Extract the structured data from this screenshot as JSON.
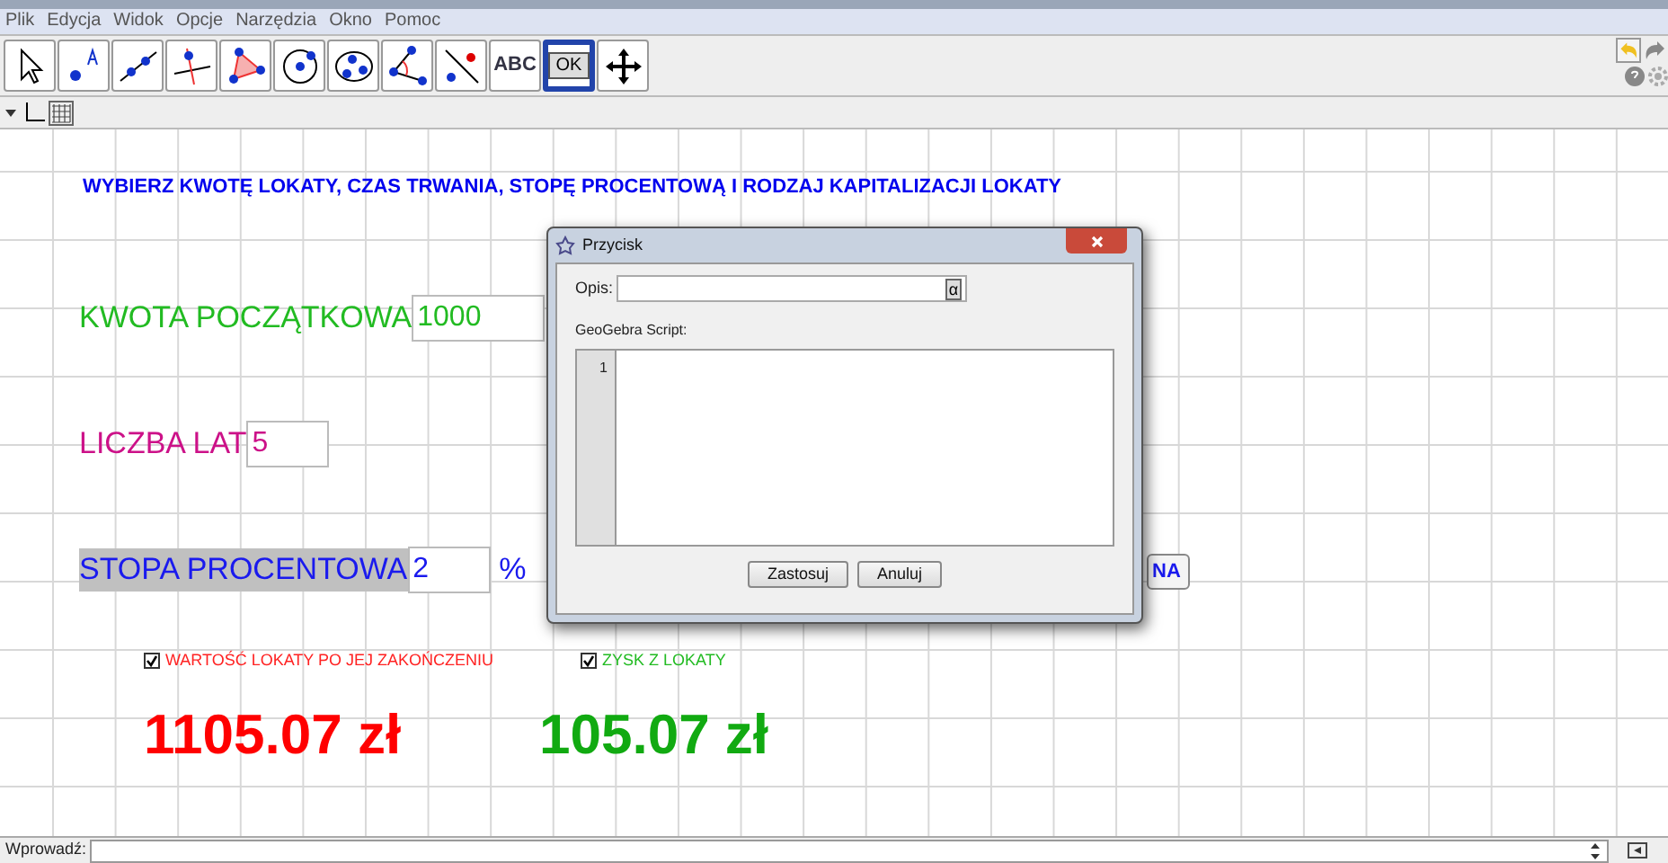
{
  "menu": [
    "Plik",
    "Edycja",
    "Widok",
    "Opcje",
    "Narzędzia",
    "Okno",
    "Pomoc"
  ],
  "tools": [
    {
      "kind": "pointer",
      "selected": false
    },
    {
      "kind": "point",
      "selected": false
    },
    {
      "kind": "line",
      "selected": false
    },
    {
      "kind": "perpendicular",
      "selected": false
    },
    {
      "kind": "polygon",
      "selected": false
    },
    {
      "kind": "circle",
      "selected": false
    },
    {
      "kind": "conic",
      "selected": false
    },
    {
      "kind": "angle",
      "selected": false
    },
    {
      "kind": "reflect",
      "selected": false
    },
    {
      "kind": "text",
      "label": "ABC",
      "selected": false
    },
    {
      "kind": "button",
      "label": "OK",
      "selected": true
    },
    {
      "kind": "move",
      "selected": false
    }
  ],
  "canvas": {
    "heading": "WYBIERZ KWOTĘ LOKATY, CZAS TRWANIA, STOPĘ PROCENTOWĄ I RODZAJ KAPITALIZACJI LOKATY",
    "inputs": [
      {
        "label": "KWOTA POCZĄTKOWA",
        "value": "1000",
        "color": "#22bb22",
        "highlighted": false
      },
      {
        "label": "LICZBA LAT",
        "value": "5",
        "color": "#cc1188",
        "highlighted": false
      },
      {
        "label": "STOPA PROCENTOWA",
        "value": "2",
        "suffix": "%",
        "color": "#1a1aee",
        "highlighted": true
      }
    ],
    "hidden_button": "NA",
    "checkboxes": [
      {
        "label": "WARTOŚĆ LOKATY PO JEJ ZAKOŃCZENIU",
        "checked": true,
        "color": "#ff2222"
      },
      {
        "label": "ZYSK Z LOKATY",
        "checked": true,
        "color": "#22bb22"
      }
    ],
    "results": [
      {
        "text": "1105.07 zł",
        "color": "#ff0000"
      },
      {
        "text": "105.07 zł",
        "color": "#11aa11"
      }
    ]
  },
  "dialog": {
    "title": "Przycisk",
    "caption_label": "Opis:",
    "caption_button": "α",
    "script_label": "GeoGebra Script:",
    "line_number": "1",
    "buttons": [
      "Zastosuj",
      "Anuluj"
    ]
  },
  "input_bar": {
    "label": "Wprowadź:"
  }
}
